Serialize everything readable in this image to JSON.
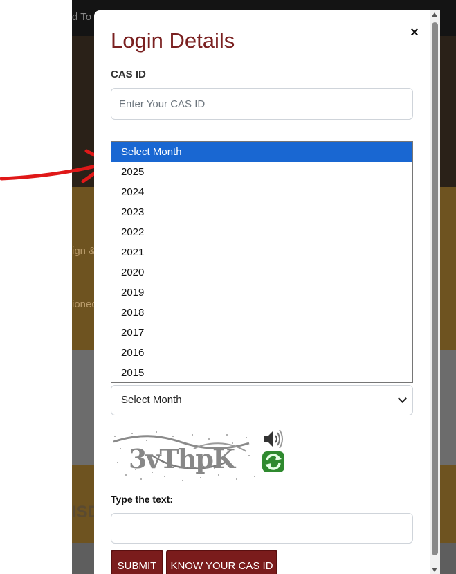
{
  "background": {
    "fragment_top": "d To",
    "fragment_mid1": "ign &",
    "fragment_mid2": "ioned",
    "fragment_bottom": "ISD"
  },
  "modal": {
    "title": "Login Details",
    "close_symbol": "×",
    "cas_label": "CAS ID",
    "cas_placeholder": "Enter Your CAS ID",
    "dropdown_options": [
      "Select Month",
      "2025",
      "2024",
      "2023",
      "2022",
      "2021",
      "2020",
      "2019",
      "2018",
      "2017",
      "2016",
      "2015"
    ],
    "selected_option_index": 0,
    "month_select_value": "Select Month",
    "captcha_text": "3vThpK",
    "type_text_label": "Type the text:",
    "type_text_value": "",
    "submit_label": "SUBMIT",
    "know_cas_label": "KNOW YOUR CAS ID"
  },
  "colors": {
    "title": "#7a2020",
    "button": "#7a1c1c",
    "selected_option": "#1967d2",
    "arrow": "#e01818"
  },
  "icons": [
    "close-icon",
    "speaker-icon",
    "refresh-icon",
    "chevron-down-icon",
    "red-arrow-annotation"
  ]
}
